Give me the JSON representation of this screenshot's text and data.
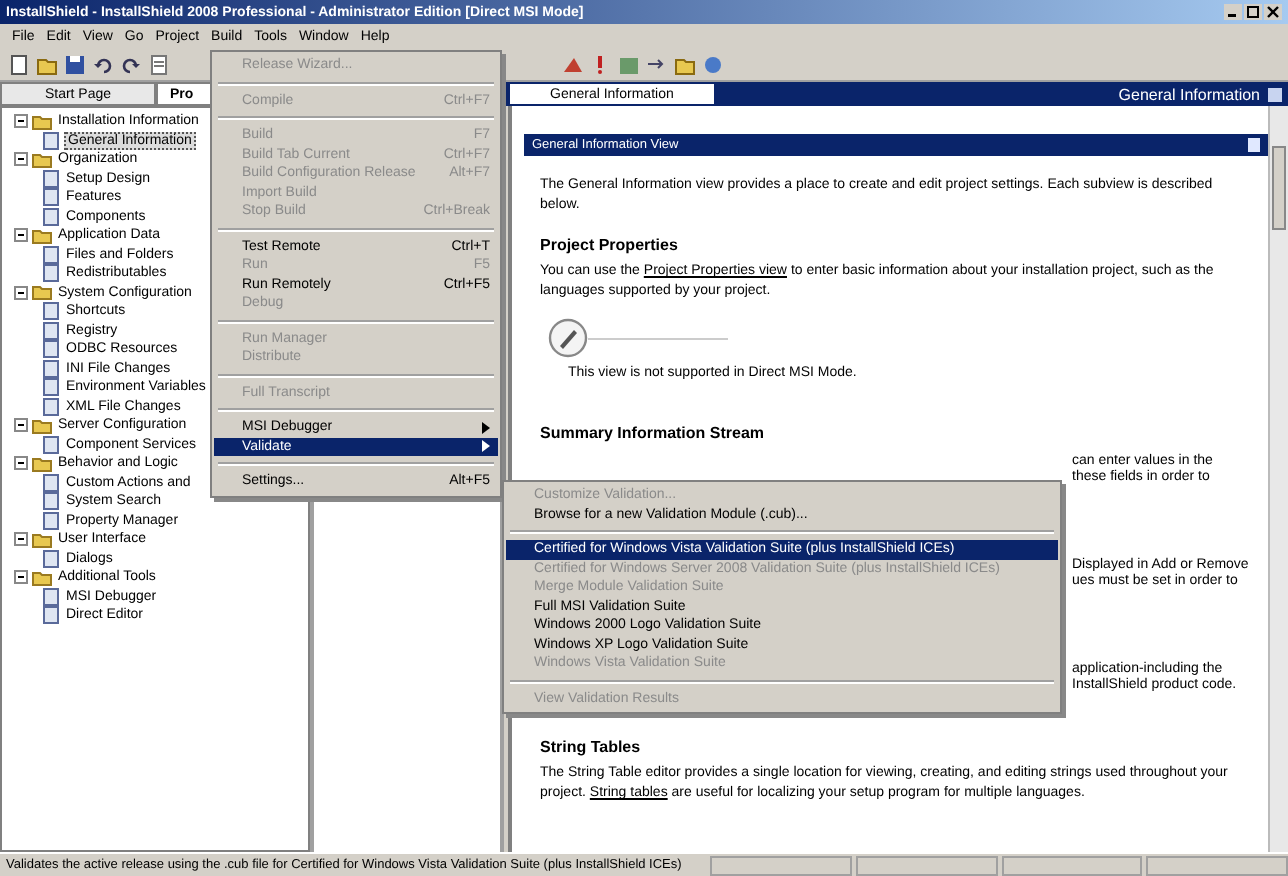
{
  "window": {
    "title": "InstallShield - InstallShield 2008 Professional - Administrator Edition [Direct MSI Mode]"
  },
  "menu_bar": [
    "File",
    "Edit",
    "View",
    "Go",
    "Project",
    "Build",
    "Tools",
    "Window",
    "Help"
  ],
  "left_tabs": [
    {
      "label": "Start Page",
      "selected": false
    },
    {
      "label": "Pro",
      "selected": true
    }
  ],
  "tree": [
    {
      "label": "Installation Information",
      "expanded": true,
      "children": [
        {
          "label": "General Information",
          "selected": true
        }
      ]
    },
    {
      "label": "Organization",
      "expanded": true,
      "children": [
        {
          "label": "Setup Design",
          "selected": false
        },
        {
          "label": "Features",
          "selected": false
        },
        {
          "label": "Components",
          "selected": false
        }
      ]
    },
    {
      "label": "Application Data",
      "expanded": true,
      "children": [
        {
          "label": "Files and Folders",
          "selected": false
        },
        {
          "label": "Redistributables",
          "selected": false
        }
      ]
    },
    {
      "label": "System Configuration",
      "expanded": true,
      "children": [
        {
          "label": "Shortcuts",
          "selected": false
        },
        {
          "label": "Registry",
          "selected": false
        },
        {
          "label": "ODBC Resources",
          "selected": false
        },
        {
          "label": "INI File Changes",
          "selected": false
        },
        {
          "label": "Environment Variables",
          "selected": false
        },
        {
          "label": "XML File Changes",
          "selected": false
        }
      ]
    },
    {
      "label": "Server Configuration",
      "expanded": true,
      "children": [
        {
          "label": "Component Services",
          "selected": false
        }
      ]
    },
    {
      "label": "Behavior and Logic",
      "expanded": true,
      "children": [
        {
          "label": "Custom Actions and",
          "selected": false
        },
        {
          "label": "System Search",
          "selected": false
        },
        {
          "label": "Property Manager",
          "selected": false
        }
      ]
    },
    {
      "label": "User Interface",
      "expanded": true,
      "children": [
        {
          "label": "Dialogs",
          "selected": false
        }
      ]
    },
    {
      "label": "Additional Tools",
      "expanded": true,
      "children": [
        {
          "label": "MSI Debugger",
          "selected": false
        },
        {
          "label": "Direct Editor",
          "selected": false
        }
      ]
    }
  ],
  "right_tab": {
    "label": "General Information"
  },
  "right_caption": "General Information",
  "view_header": "General Information View",
  "content": [
    {
      "kind": "para",
      "segments": [
        {
          "text": "The General Information view provides a place to create and edit project settings. Each subview is described below.",
          "link": false
        }
      ]
    },
    {
      "kind": "heading",
      "text": "Project Properties"
    },
    {
      "kind": "para",
      "segments": [
        {
          "text": "You can use the ",
          "link": false
        },
        {
          "text": "Project Properties view",
          "link": true
        },
        {
          "text": " to enter basic information about your installation project, such as the languages supported by your project.",
          "link": false
        }
      ]
    },
    {
      "kind": "figure",
      "caption": "This view is not supported in Direct MSI Mode."
    },
    {
      "kind": "heading",
      "text": "Summary Information Stream"
    },
    {
      "kind": "tail",
      "text": "can enter values in the"
    },
    {
      "kind": "tail",
      "text": "these fields in order to"
    },
    {
      "kind": "gap"
    },
    {
      "kind": "tail",
      "text": "Displayed in Add or Remove"
    },
    {
      "kind": "tail",
      "text": "ues must be set in order to"
    },
    {
      "kind": "gap"
    },
    {
      "kind": "tail",
      "text": "application-including the"
    },
    {
      "kind": "tail",
      "text": "InstallShield product code."
    },
    {
      "kind": "heading",
      "text": "String Tables"
    },
    {
      "kind": "para",
      "segments": [
        {
          "text": "The String Table editor provides a single location for viewing, creating, and editing strings used throughout your project. ",
          "link": false
        },
        {
          "text": "String tables",
          "link": true
        },
        {
          "text": " are useful for localizing your setup program for multiple languages.",
          "link": false
        }
      ]
    }
  ],
  "build_menu": [
    {
      "kind": "item",
      "label": "Release Wizard...",
      "disabled": true,
      "submenu": false,
      "selected": false
    },
    {
      "kind": "separator"
    },
    {
      "kind": "item",
      "label": "Compile",
      "shortcut": "Ctrl+F7",
      "disabled": true,
      "submenu": false,
      "selected": false
    },
    {
      "kind": "separator"
    },
    {
      "kind": "item",
      "label": "Build",
      "shortcut": "F7",
      "disabled": true,
      "submenu": false,
      "selected": false
    },
    {
      "kind": "item",
      "label": "Build Tab Current",
      "shortcut": "Ctrl+F7",
      "disabled": true,
      "submenu": false,
      "selected": false
    },
    {
      "kind": "item",
      "label": "Build Configuration Release",
      "shortcut": "Alt+F7",
      "disabled": true,
      "submenu": false,
      "selected": false
    },
    {
      "kind": "item",
      "label": "Import Build",
      "disabled": true,
      "submenu": false,
      "selected": false
    },
    {
      "kind": "item",
      "label": "Stop Build",
      "shortcut": "Ctrl+Break",
      "disabled": true,
      "submenu": false,
      "selected": false
    },
    {
      "kind": "separator"
    },
    {
      "kind": "item",
      "label": "Test Remote",
      "shortcut": "Ctrl+T",
      "disabled": false,
      "submenu": false,
      "selected": false
    },
    {
      "kind": "item",
      "label": "Run",
      "shortcut": "F5",
      "disabled": true,
      "submenu": false,
      "selected": false
    },
    {
      "kind": "item",
      "label": "Run Remotely",
      "shortcut": "Ctrl+F5",
      "disabled": false,
      "submenu": false,
      "selected": false
    },
    {
      "kind": "item",
      "label": "Debug",
      "disabled": true,
      "submenu": false,
      "selected": false
    },
    {
      "kind": "separator"
    },
    {
      "kind": "item",
      "label": "Run Manager",
      "disabled": true,
      "submenu": false,
      "selected": false
    },
    {
      "kind": "item",
      "label": "Distribute",
      "disabled": true,
      "submenu": false,
      "selected": false
    },
    {
      "kind": "separator"
    },
    {
      "kind": "item",
      "label": "Full Transcript",
      "disabled": true,
      "submenu": false,
      "selected": false
    },
    {
      "kind": "separator"
    },
    {
      "kind": "item",
      "label": "MSI Debugger",
      "disabled": false,
      "submenu": true,
      "selected": false
    },
    {
      "kind": "item",
      "label": "Validate",
      "disabled": false,
      "submenu": true,
      "selected": true
    },
    {
      "kind": "separator"
    },
    {
      "kind": "item",
      "label": "Settings...",
      "shortcut": "Alt+F5",
      "disabled": false,
      "submenu": false,
      "selected": false
    }
  ],
  "validate_menu": [
    {
      "kind": "item",
      "label": "Customize Validation...",
      "disabled": true,
      "selected": false
    },
    {
      "kind": "item",
      "label": "Browse for a new Validation Module (.cub)...",
      "disabled": false,
      "selected": false
    },
    {
      "kind": "separator"
    },
    {
      "kind": "item",
      "label": "Certified for Windows Vista Validation Suite (plus InstallShield ICEs)",
      "disabled": false,
      "selected": true
    },
    {
      "kind": "item",
      "label": "Certified for Windows Server 2008 Validation Suite (plus InstallShield ICEs)",
      "disabled": true,
      "selected": false
    },
    {
      "kind": "item",
      "label": "Merge Module Validation Suite",
      "disabled": true,
      "selected": false
    },
    {
      "kind": "item",
      "label": "Full MSI Validation Suite",
      "disabled": false,
      "selected": false
    },
    {
      "kind": "item",
      "label": "Windows 2000 Logo Validation Suite",
      "disabled": false,
      "selected": false
    },
    {
      "kind": "item",
      "label": "Windows XP Logo Validation Suite",
      "disabled": false,
      "selected": false
    },
    {
      "kind": "item",
      "label": "Windows Vista Validation Suite",
      "disabled": true,
      "selected": false
    },
    {
      "kind": "separator"
    },
    {
      "kind": "item",
      "label": "View Validation Results",
      "disabled": true,
      "selected": false
    }
  ],
  "status_bar": {
    "text": "Validates the active release using the .cub file for Certified for Windows Vista Validation Suite (plus InstallShield ICEs)"
  }
}
